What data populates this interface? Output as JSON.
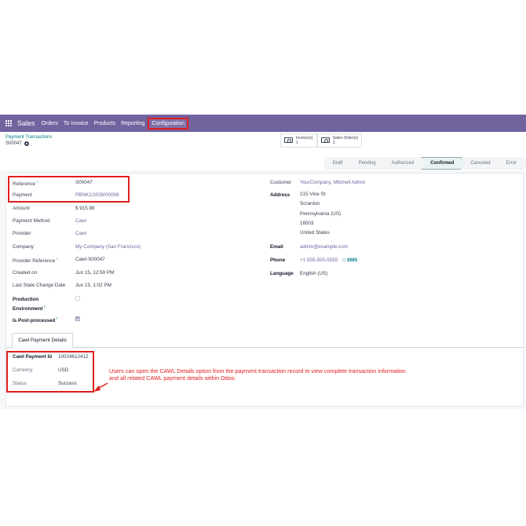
{
  "navbar": {
    "app_name": "Sales",
    "menu": [
      "Orders",
      "To Invoice",
      "Products",
      "Reporting",
      "Configuration"
    ],
    "active_menu": "Configuration"
  },
  "breadcrumb": {
    "parent": "Payment Transactions",
    "current": "S00047"
  },
  "smart_buttons": [
    {
      "label": "Invoice(s)",
      "count": "1",
      "icon": "money-icon"
    },
    {
      "label": "Sales Order(s)",
      "count": "1",
      "icon": "money-icon"
    }
  ],
  "status_stages": [
    "Draft",
    "Pending",
    "Authorized",
    "Confirmed",
    "Canceled",
    "Error"
  ],
  "status_current": "Confirmed",
  "left_fields": {
    "reference": {
      "label": "Reference",
      "help": "?",
      "value": "S00047"
    },
    "payment": {
      "label": "Payment",
      "value": "PBNK1/2026/00006"
    },
    "amount": {
      "label": "Amount",
      "value": "$ 915.98"
    },
    "payment_method": {
      "label": "Payment Method",
      "value": "Cawl"
    },
    "provider": {
      "label": "Provider",
      "value": "Cawl"
    },
    "company": {
      "label": "Company",
      "value": "My Company (San Francisco)"
    },
    "provider_reference": {
      "label": "Provider Reference",
      "help": "?",
      "value": "Cawl-S00047"
    },
    "created_on": {
      "label": "Created on",
      "value": "Jun 15, 12:59 PM"
    },
    "last_state_change": {
      "label": "Last State Change Date",
      "value": "Jun 15, 1:02 PM"
    },
    "production_environment": {
      "label_line1": "Production",
      "label_line2": "Environment",
      "help": "?",
      "checked": false
    },
    "is_post_processed": {
      "label": "Is Post-processed",
      "help": "?",
      "checked": true
    }
  },
  "right_fields": {
    "customer": {
      "label": "Customer",
      "value": "YourCompany, Mitchell Admin"
    },
    "address": {
      "label": "Address",
      "lines": [
        "215 Vine St",
        "Scranton",
        "Pennsylvania (US)",
        "18503",
        "United States"
      ]
    },
    "email": {
      "label": "Email",
      "value": "admin@example.com"
    },
    "phone": {
      "label": "Phone",
      "value": "+1 555-555-5555",
      "sms": "SMS"
    },
    "language": {
      "label": "Language",
      "value": "English (US)"
    }
  },
  "tab": {
    "label": "Cawl Payment Details"
  },
  "cawl_details": {
    "payment_id": {
      "label": "Cawl Payment Id",
      "value": "10024612412"
    },
    "currency": {
      "label": "Currency",
      "value": "USD"
    },
    "status": {
      "label": "Status",
      "value": "Success"
    }
  },
  "annotation": {
    "text": "Users can open the CAWL Details option from the payment transaction record to view complete transaction information and all related CAWL payment details within Odoo."
  },
  "colors": {
    "navbar": "#71639e",
    "highlight": "#e11d1d",
    "link": "#71639e",
    "accent": "#017e84"
  }
}
